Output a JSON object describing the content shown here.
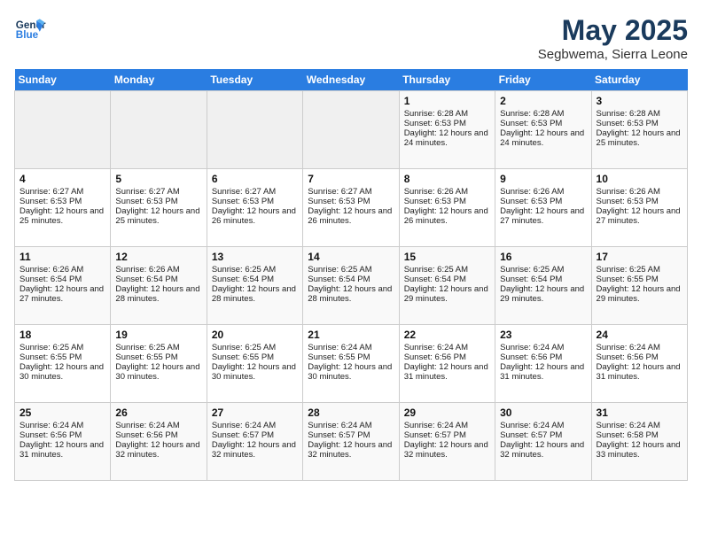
{
  "header": {
    "logo_line1": "General",
    "logo_line2": "Blue",
    "month": "May 2025",
    "location": "Segbwema, Sierra Leone"
  },
  "days_of_week": [
    "Sunday",
    "Monday",
    "Tuesday",
    "Wednesday",
    "Thursday",
    "Friday",
    "Saturday"
  ],
  "weeks": [
    [
      {
        "day": "",
        "empty": true
      },
      {
        "day": "",
        "empty": true
      },
      {
        "day": "",
        "empty": true
      },
      {
        "day": "",
        "empty": true
      },
      {
        "day": "1",
        "sunrise": "6:28 AM",
        "sunset": "6:53 PM",
        "daylight": "12 hours and 24 minutes."
      },
      {
        "day": "2",
        "sunrise": "6:28 AM",
        "sunset": "6:53 PM",
        "daylight": "12 hours and 24 minutes."
      },
      {
        "day": "3",
        "sunrise": "6:28 AM",
        "sunset": "6:53 PM",
        "daylight": "12 hours and 25 minutes."
      }
    ],
    [
      {
        "day": "4",
        "sunrise": "6:27 AM",
        "sunset": "6:53 PM",
        "daylight": "12 hours and 25 minutes."
      },
      {
        "day": "5",
        "sunrise": "6:27 AM",
        "sunset": "6:53 PM",
        "daylight": "12 hours and 25 minutes."
      },
      {
        "day": "6",
        "sunrise": "6:27 AM",
        "sunset": "6:53 PM",
        "daylight": "12 hours and 26 minutes."
      },
      {
        "day": "7",
        "sunrise": "6:27 AM",
        "sunset": "6:53 PM",
        "daylight": "12 hours and 26 minutes."
      },
      {
        "day": "8",
        "sunrise": "6:26 AM",
        "sunset": "6:53 PM",
        "daylight": "12 hours and 26 minutes."
      },
      {
        "day": "9",
        "sunrise": "6:26 AM",
        "sunset": "6:53 PM",
        "daylight": "12 hours and 27 minutes."
      },
      {
        "day": "10",
        "sunrise": "6:26 AM",
        "sunset": "6:53 PM",
        "daylight": "12 hours and 27 minutes."
      }
    ],
    [
      {
        "day": "11",
        "sunrise": "6:26 AM",
        "sunset": "6:54 PM",
        "daylight": "12 hours and 27 minutes."
      },
      {
        "day": "12",
        "sunrise": "6:26 AM",
        "sunset": "6:54 PM",
        "daylight": "12 hours and 28 minutes."
      },
      {
        "day": "13",
        "sunrise": "6:25 AM",
        "sunset": "6:54 PM",
        "daylight": "12 hours and 28 minutes."
      },
      {
        "day": "14",
        "sunrise": "6:25 AM",
        "sunset": "6:54 PM",
        "daylight": "12 hours and 28 minutes."
      },
      {
        "day": "15",
        "sunrise": "6:25 AM",
        "sunset": "6:54 PM",
        "daylight": "12 hours and 29 minutes."
      },
      {
        "day": "16",
        "sunrise": "6:25 AM",
        "sunset": "6:54 PM",
        "daylight": "12 hours and 29 minutes."
      },
      {
        "day": "17",
        "sunrise": "6:25 AM",
        "sunset": "6:55 PM",
        "daylight": "12 hours and 29 minutes."
      }
    ],
    [
      {
        "day": "18",
        "sunrise": "6:25 AM",
        "sunset": "6:55 PM",
        "daylight": "12 hours and 30 minutes."
      },
      {
        "day": "19",
        "sunrise": "6:25 AM",
        "sunset": "6:55 PM",
        "daylight": "12 hours and 30 minutes."
      },
      {
        "day": "20",
        "sunrise": "6:25 AM",
        "sunset": "6:55 PM",
        "daylight": "12 hours and 30 minutes."
      },
      {
        "day": "21",
        "sunrise": "6:24 AM",
        "sunset": "6:55 PM",
        "daylight": "12 hours and 30 minutes."
      },
      {
        "day": "22",
        "sunrise": "6:24 AM",
        "sunset": "6:56 PM",
        "daylight": "12 hours and 31 minutes."
      },
      {
        "day": "23",
        "sunrise": "6:24 AM",
        "sunset": "6:56 PM",
        "daylight": "12 hours and 31 minutes."
      },
      {
        "day": "24",
        "sunrise": "6:24 AM",
        "sunset": "6:56 PM",
        "daylight": "12 hours and 31 minutes."
      }
    ],
    [
      {
        "day": "25",
        "sunrise": "6:24 AM",
        "sunset": "6:56 PM",
        "daylight": "12 hours and 31 minutes."
      },
      {
        "day": "26",
        "sunrise": "6:24 AM",
        "sunset": "6:56 PM",
        "daylight": "12 hours and 32 minutes."
      },
      {
        "day": "27",
        "sunrise": "6:24 AM",
        "sunset": "6:57 PM",
        "daylight": "12 hours and 32 minutes."
      },
      {
        "day": "28",
        "sunrise": "6:24 AM",
        "sunset": "6:57 PM",
        "daylight": "12 hours and 32 minutes."
      },
      {
        "day": "29",
        "sunrise": "6:24 AM",
        "sunset": "6:57 PM",
        "daylight": "12 hours and 32 minutes."
      },
      {
        "day": "30",
        "sunrise": "6:24 AM",
        "sunset": "6:57 PM",
        "daylight": "12 hours and 32 minutes."
      },
      {
        "day": "31",
        "sunrise": "6:24 AM",
        "sunset": "6:58 PM",
        "daylight": "12 hours and 33 minutes."
      }
    ]
  ]
}
